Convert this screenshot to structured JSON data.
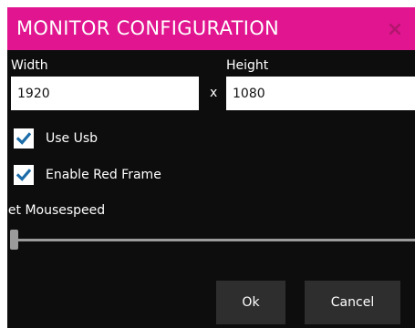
{
  "window": {
    "title": "MONITOR CONFIGURATION",
    "close_icon": "close-icon"
  },
  "resolution": {
    "width_label": "Width",
    "width_value": "1920",
    "separator": "x",
    "height_label": "Height",
    "height_value": "1080"
  },
  "options": {
    "use_usb": {
      "label": "Use Usb",
      "checked": true
    },
    "enable_red_frame": {
      "label": "Enable Red Frame",
      "checked": true
    }
  },
  "mousespeed": {
    "label": "Set Mousespeed",
    "value": 0
  },
  "buttons": {
    "ok_label": "Ok",
    "cancel_label": "Cancel"
  },
  "colors": {
    "titlebar": "#e0158f",
    "background": "#0d0d0d",
    "checkmark": "#1b6ca8",
    "button": "#2e2e2e",
    "slider": "#9b9b9b"
  }
}
